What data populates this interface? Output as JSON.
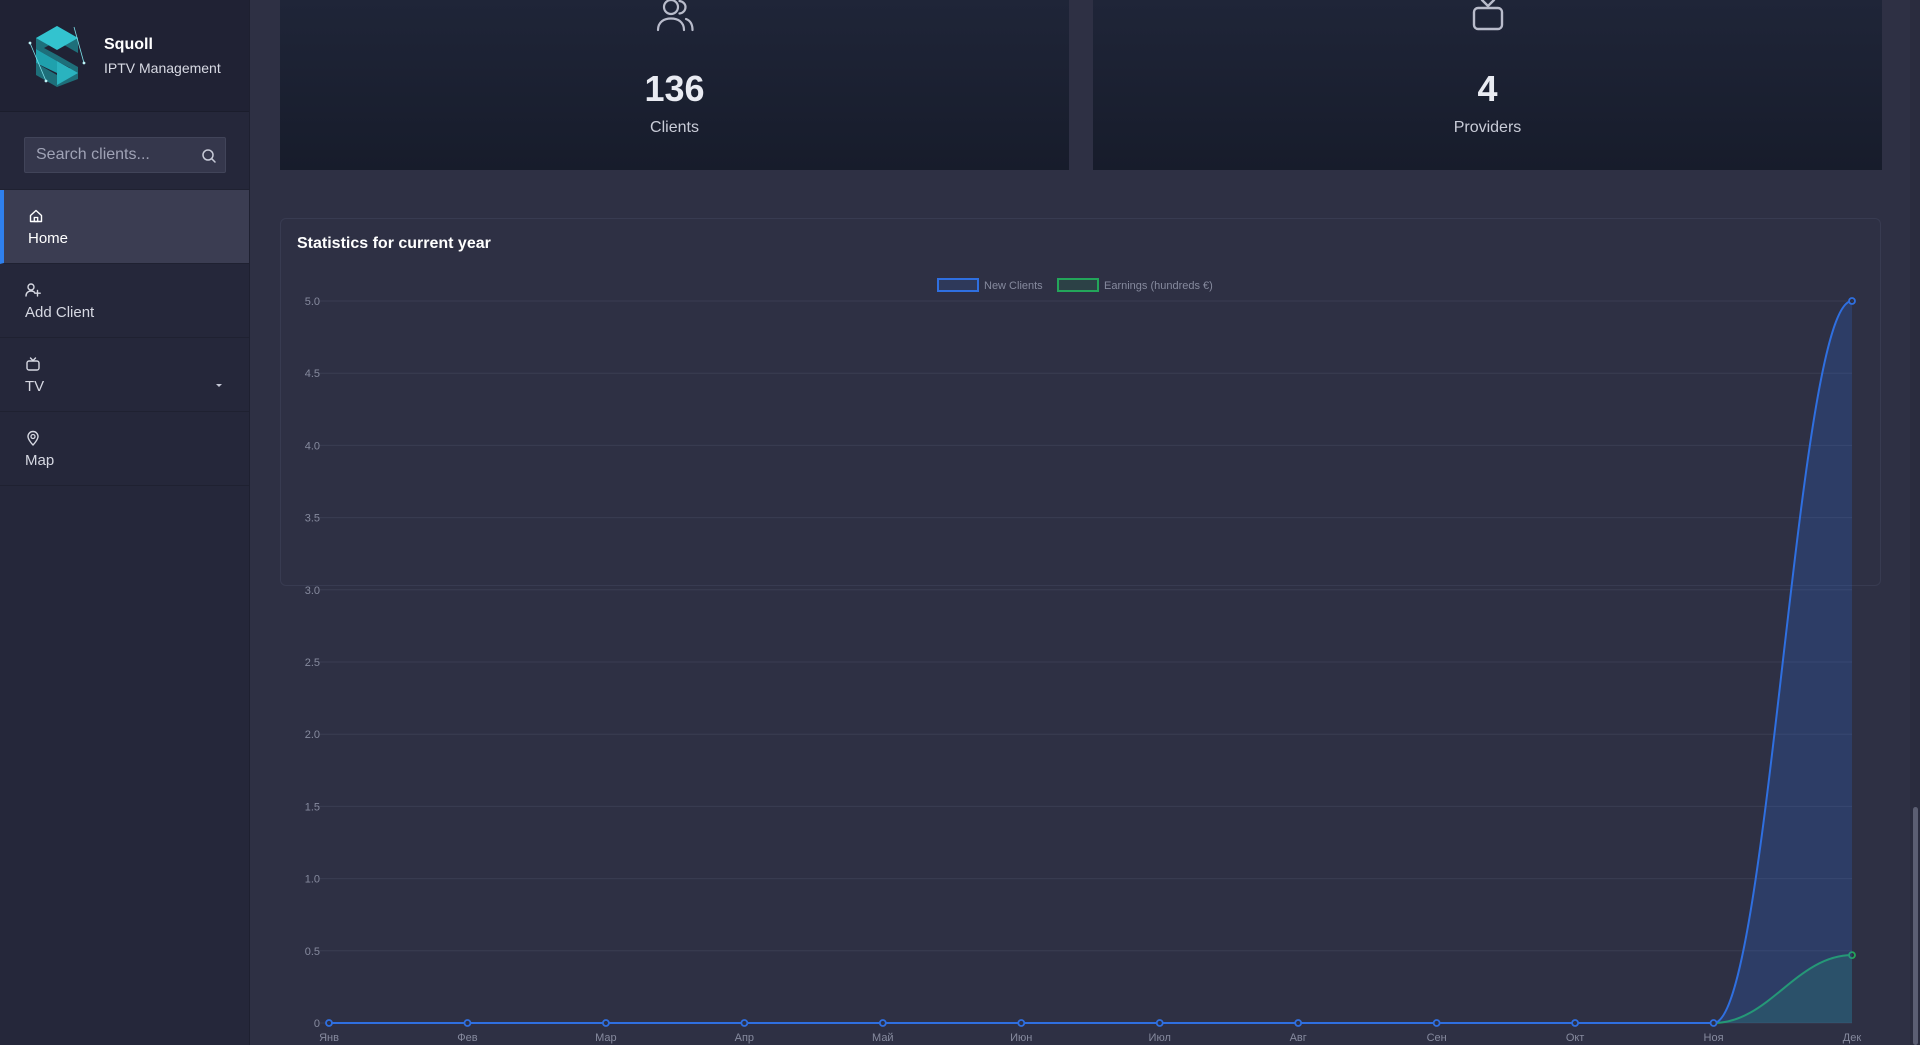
{
  "brand": {
    "name": "Squoll",
    "subtitle": "IPTV Management",
    "logo_icon": "squoll-logo-icon"
  },
  "search": {
    "placeholder": "Search clients...",
    "value": "",
    "icon": "search-icon"
  },
  "nav": {
    "items": [
      {
        "label": "Home",
        "icon": "home-icon",
        "active": true
      },
      {
        "label": "Add Client",
        "icon": "add-user-icon",
        "active": false
      },
      {
        "label": "TV",
        "icon": "tv-icon",
        "active": false,
        "has_dropdown": true
      },
      {
        "label": "Map",
        "icon": "map-pin-icon",
        "active": false
      }
    ]
  },
  "cards": [
    {
      "value": "136",
      "label": "Clients",
      "icon": "users-icon"
    },
    {
      "value": "4",
      "label": "Providers",
      "icon": "tv-icon"
    }
  ],
  "stats": {
    "title": "Statistics for current year"
  },
  "colors": {
    "accent": "#2f80ed",
    "new_clients": "#2f6fe0",
    "earnings": "#23a55a",
    "sidebar": "#25273a",
    "background": "#2e3044"
  },
  "chart_data": {
    "type": "line",
    "categories": [
      "Янв",
      "Фев",
      "Мар",
      "Апр",
      "Май",
      "Июн",
      "Июл",
      "Авг",
      "Сен",
      "Окт",
      "Ноя",
      "Дек"
    ],
    "series": [
      {
        "name": "New Clients",
        "values": [
          0,
          0,
          0,
          0,
          0,
          0,
          0,
          0,
          0,
          0,
          0,
          5
        ],
        "color": "#2f6fe0"
      },
      {
        "name": "Earnings (hundreds €)",
        "values": [
          0,
          0,
          0,
          0,
          0,
          0,
          0,
          0,
          0,
          0,
          0,
          0.47
        ],
        "color": "#23a55a"
      }
    ],
    "yticks": [
      "0",
      "0.5",
      "1.0",
      "1.5",
      "2.0",
      "2.5",
      "3.0",
      "3.5",
      "4.0",
      "4.5",
      "5.0"
    ],
    "ylim": [
      0,
      5
    ],
    "grid": true,
    "legend": "top-center",
    "fill": true
  }
}
